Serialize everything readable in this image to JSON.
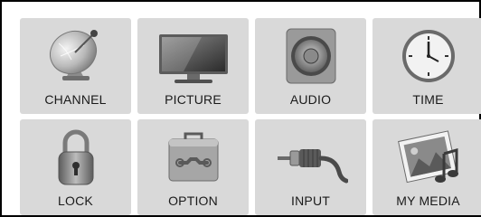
{
  "menu": {
    "items": [
      {
        "label": "CHANNEL",
        "icon": "satellite-dish-icon"
      },
      {
        "label": "PICTURE",
        "icon": "tv-icon"
      },
      {
        "label": "AUDIO",
        "icon": "speaker-icon"
      },
      {
        "label": "TIME",
        "icon": "clock-icon"
      },
      {
        "label": "LOCK",
        "icon": "padlock-icon"
      },
      {
        "label": "OPTION",
        "icon": "toolbox-icon"
      },
      {
        "label": "INPUT",
        "icon": "rca-cable-icon"
      },
      {
        "label": "MY MEDIA",
        "icon": "media-photo-music-icon"
      }
    ]
  },
  "colors": {
    "tile_background": "#d9d9d9",
    "frame_border": "#000000",
    "label_text": "#1a1a1a"
  }
}
